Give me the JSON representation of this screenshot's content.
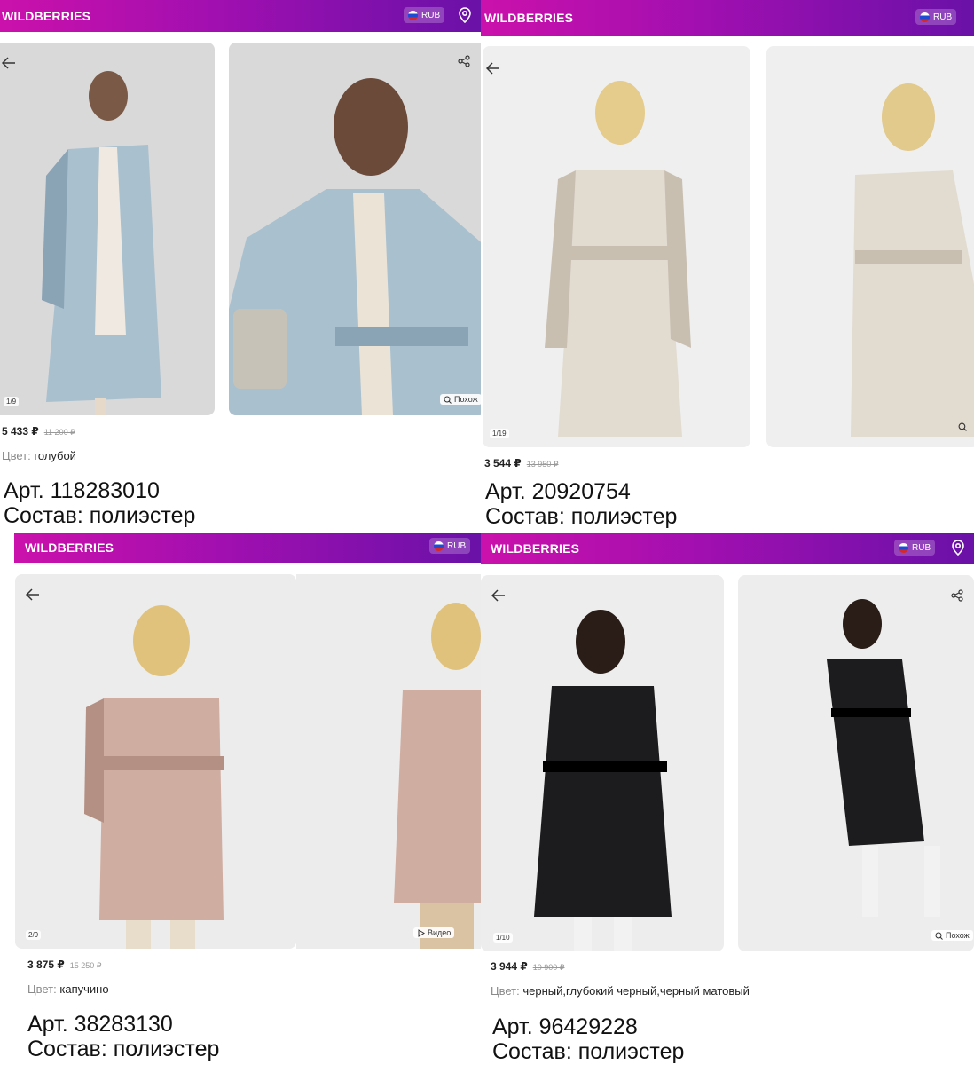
{
  "cards": [
    {
      "logo": "WILDBERRIES",
      "currency": "RUB",
      "counter": "1/9",
      "badge": "Похож",
      "price": "5 433 ₽",
      "old_price": "11 200 ₽",
      "color_label": "Цвет:",
      "color_value": "голубой",
      "article": "Арт. 118283010",
      "composition": "Состав: полиэстер",
      "colors": {
        "coat": "#a9c0cf",
        "coat_dark": "#8aa3b5",
        "bg": "#d9d9d9"
      }
    },
    {
      "logo": "WILDBERRIES",
      "currency": "RUB",
      "counter": "1/19",
      "price": "3 544 ₽",
      "old_price": "13 950 ₽",
      "article": "Арт. 20920754",
      "composition": "Состав: полиэстер",
      "colors": {
        "coat": "#e2dbd0",
        "coat_dark": "#c9bfb1",
        "bg": "#efefef"
      }
    },
    {
      "logo": "WILDBERRIES",
      "currency": "RUB",
      "counter": "2/9",
      "badge": "Видео",
      "price": "3 875 ₽",
      "old_price": "15 250 ₽",
      "color_label": "Цвет:",
      "color_value": "капучино",
      "article": "Арт. 38283130",
      "composition": "Состав: полиэстер",
      "colors": {
        "coat": "#cfada1",
        "coat_dark": "#b48f83",
        "bg": "#ececec"
      }
    },
    {
      "logo": "WILDBERRIES",
      "currency": "RUB",
      "counter": "1/10",
      "badge": "Похож",
      "price": "3 944 ₽",
      "old_price": "10 900 ₽",
      "color_label": "Цвет:",
      "color_value": "черный,глубокий черный,черный матовый",
      "article": "Арт. 96429228",
      "composition": "Состав: полиэстер",
      "colors": {
        "coat": "#1c1c1e",
        "coat_dark": "#000000",
        "bg": "#ededed"
      }
    }
  ],
  "icons": [
    "back-arrow-icon",
    "share-icon",
    "location-pin-icon",
    "russia-flag-icon",
    "similar-search-icon",
    "play-icon"
  ]
}
